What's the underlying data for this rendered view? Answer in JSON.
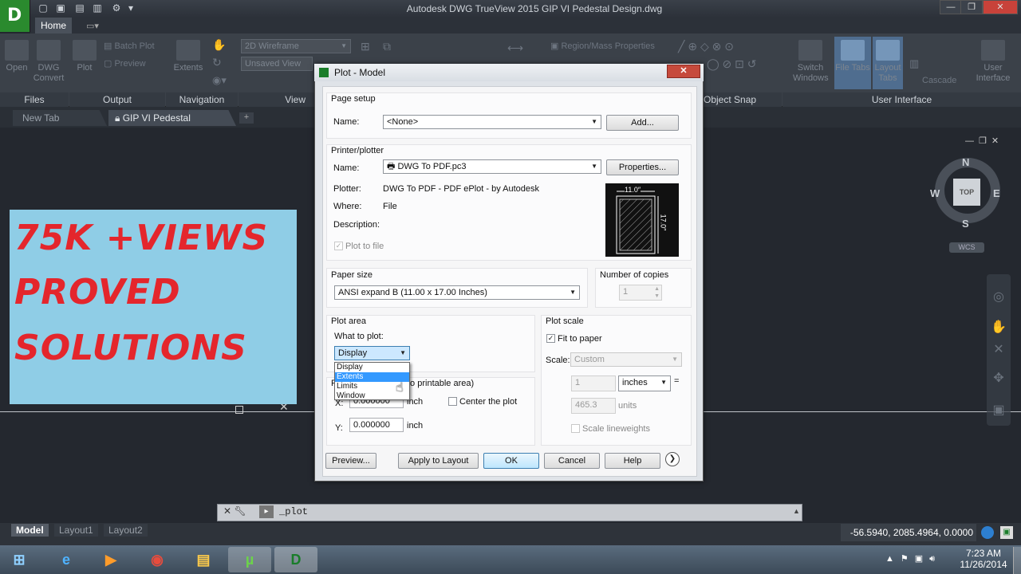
{
  "app": {
    "title": "Autodesk DWG TrueView 2015   GIP VI Pedestal Design.dwg",
    "icon_letter": "D"
  },
  "ribbon": {
    "tab": "Home",
    "buttons": {
      "open": "Open",
      "dwg_convert": "DWG\nConvert",
      "plot": "Plot",
      "batch_plot": "Batch Plot",
      "preview": "Preview",
      "extents": "Extents",
      "visual_style": "2D Wireframe",
      "unsaved_view": "Unsaved View",
      "region_mass": "Region/Mass Properties",
      "switch_windows": "Switch\nWindows",
      "file_tabs": "File Tabs",
      "layout_tabs": "Layout\nTabs",
      "cascade": "Cascade",
      "user_interface_btn": "User\nInterface"
    },
    "panels": {
      "files": "Files",
      "output": "Output",
      "navigation": "Navigation",
      "view": "View",
      "object_snap": "Object Snap",
      "user_interface": "User Interface"
    }
  },
  "doctabs": {
    "new_tab": "New Tab",
    "current": "GIP VI Pedestal Design",
    "plus": "+"
  },
  "banner": {
    "line1": "75K  +VIEWS",
    "line2": "PROVED",
    "line3": "SOLUTIONS"
  },
  "viewcube": {
    "n": "N",
    "s": "S",
    "e": "E",
    "w": "W",
    "top": "TOP",
    "wcs": "WCS"
  },
  "dialog": {
    "title": "Plot - Model",
    "page_setup": {
      "heading": "Page setup",
      "name_label": "Name:",
      "name_value": "<None>",
      "add_button": "Add..."
    },
    "printer": {
      "heading": "Printer/plotter",
      "name_label": "Name:",
      "name_value": "DWG To PDF.pc3",
      "properties_button": "Properties...",
      "plotter_label": "Plotter:",
      "plotter_value": "DWG To PDF - PDF ePlot - by Autodesk",
      "where_label": "Where:",
      "where_value": "File",
      "description_label": "Description:",
      "plot_to_file": "Plot to file",
      "preview_width": "11.0″",
      "preview_height": "17.0″"
    },
    "paper_size": {
      "heading": "Paper size",
      "value": "ANSI expand B (11.00 x 17.00 Inches)"
    },
    "copies": {
      "heading": "Number of copies",
      "value": "1"
    },
    "plot_area": {
      "heading": "Plot area",
      "what_label": "What to plot:",
      "value": "Display",
      "options": [
        "Display",
        "Extents",
        "Limits",
        "Window"
      ],
      "highlighted": "Extents"
    },
    "plot_offset": {
      "heading_fragment": "to printable area)",
      "heading_prefix": "P",
      "x_label": "X:",
      "x_value": "0.000000",
      "x_unit": "inch",
      "y_label": "Y:",
      "y_value": "0.000000",
      "y_unit": "inch",
      "center": "Center the plot"
    },
    "plot_scale": {
      "heading": "Plot scale",
      "fit": "Fit to paper",
      "scale_label": "Scale:",
      "scale_value": "Custom",
      "num": "1",
      "unit": "inches",
      "equals": "=",
      "units_value": "465.3",
      "units_label": "units",
      "lineweights": "Scale lineweights"
    },
    "buttons": {
      "preview": "Preview...",
      "apply": "Apply to Layout",
      "ok": "OK",
      "cancel": "Cancel",
      "help": "Help",
      "more": "❯"
    }
  },
  "command": {
    "text": "_plot",
    "prompt": "▸"
  },
  "layouts": [
    "Model",
    "Layout1",
    "Layout2"
  ],
  "status": {
    "coords": "-56.5940, 2085.4964, 0.0000"
  },
  "clock": {
    "time": "7:23 AM",
    "date": "11/26/2014"
  },
  "colors": {
    "banner_bg": "#8fcde6",
    "banner_text": "#e4262c",
    "ok_border": "#3c7fb1",
    "selection": "#3399ff"
  }
}
